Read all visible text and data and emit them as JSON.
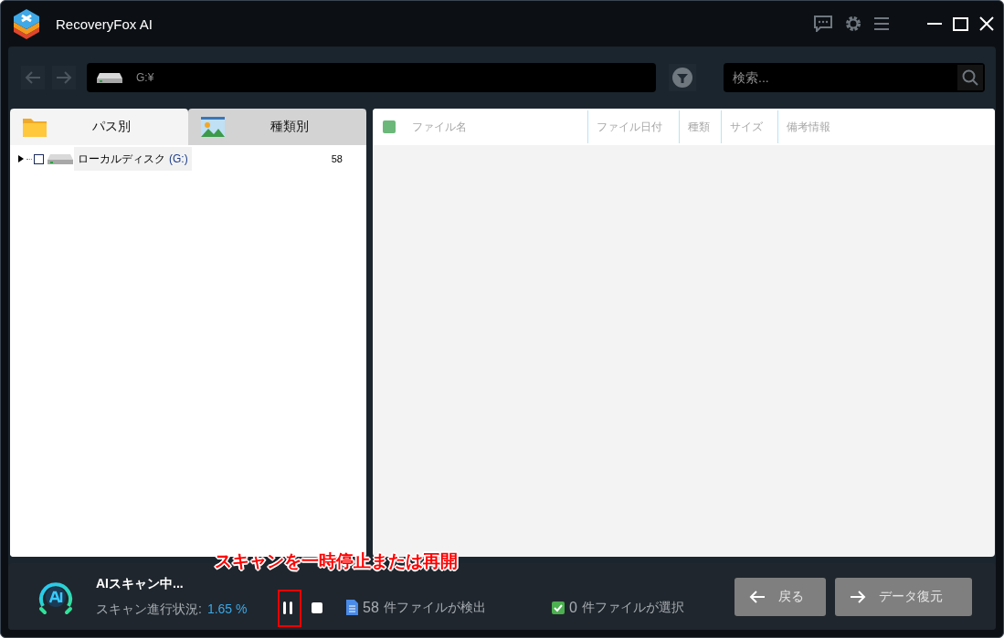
{
  "window": {
    "title": "RecoveryFox AI"
  },
  "toolbar": {
    "path": "G:¥",
    "search": {
      "placeholder": "検索..."
    }
  },
  "tabs": [
    {
      "label": "パス別",
      "selected": true,
      "kind": "folder"
    },
    {
      "label": "種類別",
      "selected": false,
      "kind": "image"
    }
  ],
  "tree": [
    {
      "label": "ローカルディスク",
      "drive": "(G:)",
      "count": "58",
      "checked": false,
      "expanded": false
    }
  ],
  "table": {
    "select_all_checked": false,
    "columns": [
      "ファイル名",
      "ファイル日付",
      "種類",
      "サイズ",
      "備考情報"
    ]
  },
  "status": {
    "title": "AIスキャン中...",
    "progress_label": "スキャン進行状況:",
    "progress_value": "1.65 %",
    "found_count": "58",
    "found_text": "件ファイルが検出",
    "selected_count": "0",
    "selected_text": "件ファイルが選択"
  },
  "buttons": [
    {
      "label": "戻る",
      "kind": "back"
    },
    {
      "label": "データ復元",
      "kind": "recover"
    }
  ],
  "annotation": {
    "text": "スキャンを一時停止または再開"
  }
}
